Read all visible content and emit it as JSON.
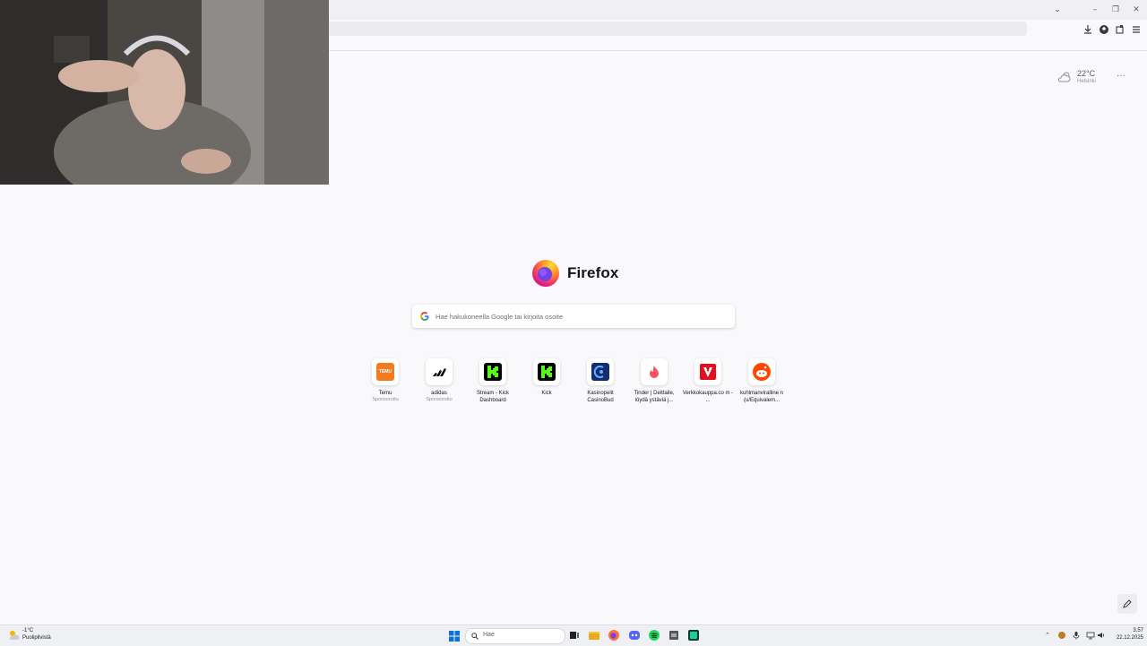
{
  "browser": {
    "window_controls": {
      "list_tabs": "⌄",
      "minimize": "–",
      "restore": "❐",
      "close": "✕"
    },
    "toolbar": {
      "downloads_icon": "download-icon",
      "account_icon": "account-icon",
      "extensions_icon": "extensions-icon",
      "menu_icon": "hamburger-icon"
    }
  },
  "newtab": {
    "weather": {
      "temp": "22°C",
      "city": "Helsinki"
    },
    "menu_label": "···",
    "brand": "Firefox",
    "search": {
      "placeholder": "Hae hakukoneella Google tai kirjoita osoite"
    },
    "tiles": [
      {
        "label": "Temu",
        "sub": "Sponsoroitu",
        "icon": "temu-icon",
        "color": "#f47a1f"
      },
      {
        "label": "adidas",
        "sub": "Sponsoroitu",
        "icon": "adidas-icon",
        "color": "#000000"
      },
      {
        "label": "Stream - Kick Dashboard",
        "sub": "",
        "icon": "kick-icon",
        "color": "#53fc18"
      },
      {
        "label": "Kick",
        "sub": "",
        "icon": "kick-icon",
        "color": "#53fc18"
      },
      {
        "label": "Kasinopelit CasinoBud",
        "sub": "",
        "icon": "casinobud-icon",
        "color": "#142c6e"
      },
      {
        "label": "Tinder | Deittaile, löydä ystäviä j...",
        "sub": "",
        "icon": "tinder-icon",
        "color": "#fd4f63"
      },
      {
        "label": "Verkkokauppa.co m - ...",
        "sub": "",
        "icon": "verkkokauppa-icon",
        "color": "#e0101e"
      },
      {
        "label": "kuhlmanviralline n (u/Equivalem...",
        "sub": "",
        "icon": "reddit-icon",
        "color": "#ff4500"
      }
    ]
  },
  "taskbar": {
    "weather": {
      "temp": "-1°C",
      "text": "Puolipilvistä"
    },
    "search_label": "Hae",
    "time": "3.57",
    "date": "22.12.2025"
  }
}
